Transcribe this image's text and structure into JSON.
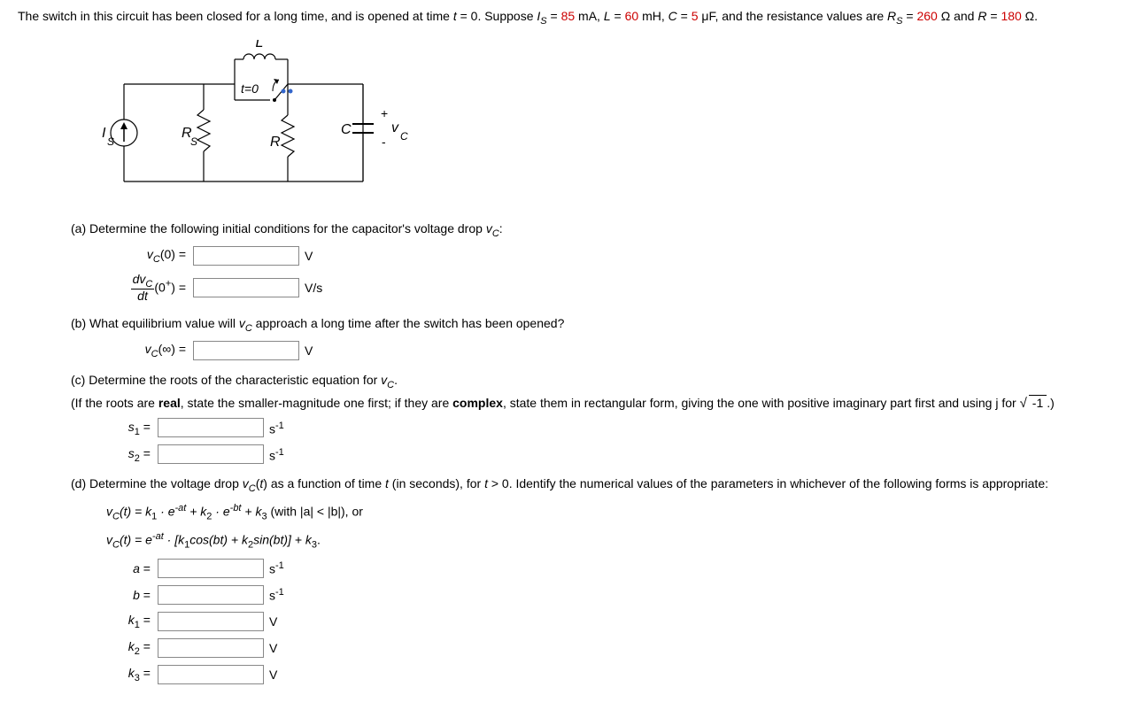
{
  "problem": {
    "intro_prefix": "The switch in this circuit has been closed for a long time, and is opened at time ",
    "t_eq": "t",
    "t_val": " = 0. Suppose ",
    "Is_label": "I",
    "Is_sub": "S",
    "Is_eq": " = ",
    "Is_val": "85",
    "Is_unit": " mA, ",
    "L_label": "L",
    "L_eq": " = ",
    "L_val": "60",
    "L_unit": " mH, ",
    "C_label": "C",
    "C_eq": " = ",
    "C_val": "5",
    "C_unit": " μF, and the resistance values are ",
    "Rs_label": "R",
    "Rs_sub": "S",
    "Rs_eq": " = ",
    "Rs_val": "260",
    "Rs_unit": " Ω and ",
    "R_label": "R",
    "R_eq": " = ",
    "R_val": "180",
    "R_unit": " Ω."
  },
  "circuit": {
    "L": "L",
    "t0": "t=0",
    "Is": "I",
    "Is_sub": "S",
    "Rs": "R",
    "Rs_sub": "S",
    "R": "R",
    "C": "C",
    "vc_plus": "+",
    "vc_minus": "-",
    "vc": "v",
    "vc_sub": "C"
  },
  "parts": {
    "a": {
      "text": "(a) Determine the following initial conditions for the capacitor's voltage drop ",
      "vc": "v",
      "vc_sub": "C",
      "colon": ":",
      "vc0_label_v": "v",
      "vc0_label_sub": "C",
      "vc0_label_arg": "(0) =",
      "vc0_unit": "V",
      "dvc_num_d": "dv",
      "dvc_num_sub": "C",
      "dvc_den": "dt",
      "dvc_arg": "(0",
      "dvc_sup": "+",
      "dvc_arg2": ") =",
      "dvc_unit": "V/s"
    },
    "b": {
      "text_prefix": "(b) What equilibrium value will ",
      "vc": "v",
      "vc_sub": "C",
      "text_suffix": " approach a long time after the switch has been opened?",
      "vcinf_v": "v",
      "vcinf_sub": "C",
      "vcinf_arg": "(∞) =",
      "vcinf_unit": "V"
    },
    "c": {
      "text_prefix": "(c) Determine the roots of the characteristic equation for ",
      "vc": "v",
      "vc_sub": "C",
      "period": ".",
      "note_prefix": "(If the roots are ",
      "real": "real",
      "note_mid": ", state the smaller-magnitude one first; if they are ",
      "complex": "complex",
      "note_suffix": ", state them in rectangular form, giving the one with positive imaginary part first and using j for ",
      "sqrt_arg": "-1",
      "note_end": ".)",
      "s1_label": "s",
      "s1_sub": "1",
      "s1_eq": " =",
      "s1_unit": "s",
      "s1_unit_sup": "-1",
      "s2_label": "s",
      "s2_sub": "2",
      "s2_eq": " =",
      "s2_unit": "s",
      "s2_unit_sup": "-1"
    },
    "d": {
      "text_prefix": "(d) Determine the voltage drop ",
      "vc": "v",
      "vc_sub": "C",
      "text_mid1": "(",
      "t": "t",
      "text_mid2": ") as a function of time ",
      "t2": "t",
      "text_mid3": " (in seconds), for ",
      "t3": "t",
      "text_suffix": " > 0. Identify the numerical values of the parameters in whichever of the following forms is appropriate:",
      "form1": "v",
      "form1_sub": "C",
      "form1_t": "(t) = k",
      "form1_k1sub": "1",
      "form1_dot1": " · e",
      "form1_exp1": "-at",
      "form1_plus1": " + k",
      "form1_k2sub": "2",
      "form1_dot2": " · e",
      "form1_exp2": "-bt",
      "form1_plus2": " + k",
      "form1_k3sub": "3",
      "form1_cond": " (with |a| < |b|), or",
      "form2": "v",
      "form2_sub": "C",
      "form2_t": "(t) = e",
      "form2_exp": "-at",
      "form2_dot": " · [k",
      "form2_k1sub": "1",
      "form2_cos": "cos(bt) + k",
      "form2_k2sub": "2",
      "form2_sin": "sin(bt)] + k",
      "form2_k3sub": "3",
      "form2_end": ".",
      "a_label": "a",
      "a_eq": " =",
      "a_unit": "s",
      "a_unit_sup": "-1",
      "b_label": "b",
      "b_eq": " =",
      "b_unit": "s",
      "b_unit_sup": "-1",
      "k1_label": "k",
      "k1_sub": "1",
      "k1_eq": " =",
      "k1_unit": "V",
      "k2_label": "k",
      "k2_sub": "2",
      "k2_eq": " =",
      "k2_unit": "V",
      "k3_label": "k",
      "k3_sub": "3",
      "k3_eq": " =",
      "k3_unit": "V"
    }
  }
}
